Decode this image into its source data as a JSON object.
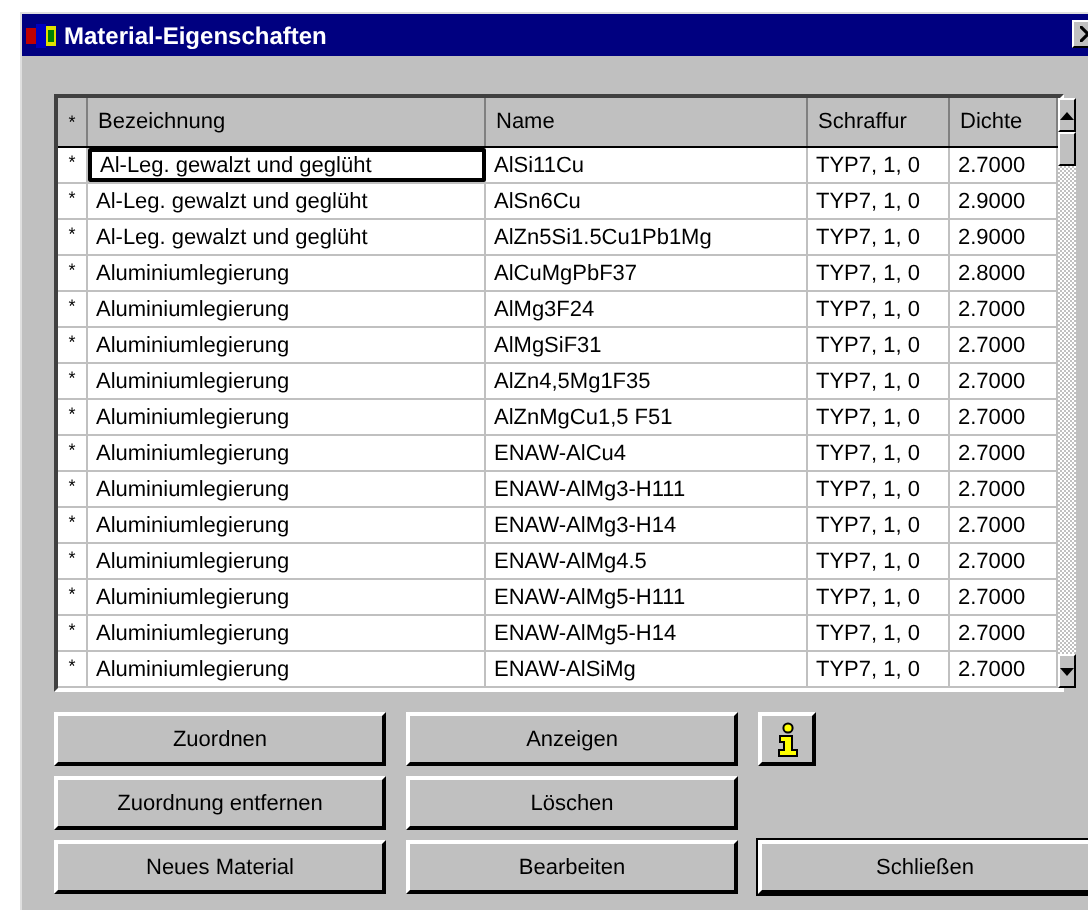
{
  "window": {
    "title": "Material-Eigenschaften"
  },
  "table": {
    "columns": [
      "*",
      "Bezeichnung",
      "Name",
      "Schraffur",
      "Dichte"
    ],
    "rows": [
      {
        "marker": "*",
        "bezeichnung": "Al-Leg. gewalzt und geglüht",
        "name": "AlSi11Cu",
        "schraffur": "TYP7, 1, 0",
        "dichte": "2.7000",
        "focused": true
      },
      {
        "marker": "*",
        "bezeichnung": "Al-Leg. gewalzt und geglüht",
        "name": "AlSn6Cu",
        "schraffur": "TYP7, 1, 0",
        "dichte": "2.9000",
        "focused": false
      },
      {
        "marker": "*",
        "bezeichnung": "Al-Leg. gewalzt und geglüht",
        "name": "AlZn5Si1.5Cu1Pb1Mg",
        "schraffur": "TYP7, 1, 0",
        "dichte": "2.9000",
        "focused": false
      },
      {
        "marker": "*",
        "bezeichnung": "Aluminiumlegierung",
        "name": "AlCuMgPbF37",
        "schraffur": "TYP7, 1, 0",
        "dichte": "2.8000",
        "focused": false
      },
      {
        "marker": "*",
        "bezeichnung": "Aluminiumlegierung",
        "name": "AlMg3F24",
        "schraffur": "TYP7, 1, 0",
        "dichte": "2.7000",
        "focused": false
      },
      {
        "marker": "*",
        "bezeichnung": "Aluminiumlegierung",
        "name": "AlMgSiF31",
        "schraffur": "TYP7, 1, 0",
        "dichte": "2.7000",
        "focused": false
      },
      {
        "marker": "*",
        "bezeichnung": "Aluminiumlegierung",
        "name": "AlZn4,5Mg1F35",
        "schraffur": "TYP7, 1, 0",
        "dichte": "2.7000",
        "focused": false
      },
      {
        "marker": "*",
        "bezeichnung": "Aluminiumlegierung",
        "name": "AlZnMgCu1,5 F51",
        "schraffur": "TYP7, 1, 0",
        "dichte": "2.7000",
        "focused": false
      },
      {
        "marker": "*",
        "bezeichnung": "Aluminiumlegierung",
        "name": "ENAW-AlCu4",
        "schraffur": "TYP7, 1, 0",
        "dichte": "2.7000",
        "focused": false
      },
      {
        "marker": "*",
        "bezeichnung": "Aluminiumlegierung",
        "name": "ENAW-AlMg3-H111",
        "schraffur": "TYP7, 1, 0",
        "dichte": "2.7000",
        "focused": false
      },
      {
        "marker": "*",
        "bezeichnung": "Aluminiumlegierung",
        "name": "ENAW-AlMg3-H14",
        "schraffur": "TYP7, 1, 0",
        "dichte": "2.7000",
        "focused": false
      },
      {
        "marker": "*",
        "bezeichnung": "Aluminiumlegierung",
        "name": "ENAW-AlMg4.5",
        "schraffur": "TYP7, 1, 0",
        "dichte": "2.7000",
        "focused": false
      },
      {
        "marker": "*",
        "bezeichnung": "Aluminiumlegierung",
        "name": "ENAW-AlMg5-H111",
        "schraffur": "TYP7, 1, 0",
        "dichte": "2.7000",
        "focused": false
      },
      {
        "marker": "*",
        "bezeichnung": "Aluminiumlegierung",
        "name": "ENAW-AlMg5-H14",
        "schraffur": "TYP7, 1, 0",
        "dichte": "2.7000",
        "focused": false
      },
      {
        "marker": "*",
        "bezeichnung": "Aluminiumlegierung",
        "name": "ENAW-AlSiMg",
        "schraffur": "TYP7, 1, 0",
        "dichte": "2.7000",
        "focused": false
      }
    ]
  },
  "buttons": [
    {
      "kind": "text",
      "label": "Zuordnen",
      "default": false
    },
    {
      "kind": "text",
      "label": "Anzeigen",
      "default": false
    },
    {
      "kind": "info",
      "default": false
    },
    {
      "kind": "text",
      "label": "Zuordnung entfernen",
      "default": false
    },
    {
      "kind": "text",
      "label": "Löschen",
      "default": false
    },
    {
      "kind": "empty"
    },
    {
      "kind": "text",
      "label": "Neues Material",
      "default": false
    },
    {
      "kind": "text",
      "label": "Bearbeiten",
      "default": false
    },
    {
      "kind": "text",
      "label": "Schließen",
      "default": true
    }
  ]
}
